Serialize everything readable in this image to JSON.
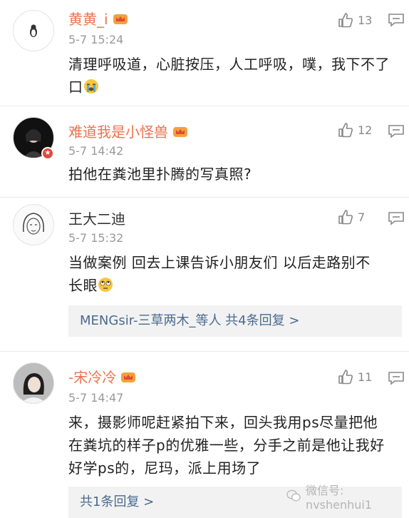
{
  "comments": [
    {
      "username": "黄黄_i",
      "time": "5-7 15:24",
      "likes": "13",
      "text_line1": "清理呼吸道，心脏按压，人工呼吸，噗，我下不了",
      "text_line2": "口",
      "avatar_icon": "penguin-icon",
      "emoji_icon": "crying-face-icon"
    },
    {
      "username": "难道我是小怪兽",
      "time": "5-7 14:42",
      "likes": "12",
      "text_line1": "拍他在粪池里扑腾的写真照?",
      "avatar_icon": "girl-avatar"
    },
    {
      "username": "王大二迪",
      "time": "5-7 15:32",
      "likes": "7",
      "text_line1": "当做案例  回去上课告诉小朋友们  以后走路别不",
      "text_line2": "长眼",
      "replies": "MENGsir-三草两木_等人  共4条回复 >",
      "avatar_icon": "sketch-woman-avatar",
      "emoji_icon": "rolling-eyes-icon"
    },
    {
      "username": "-宋冷冷",
      "time": "5-7 14:47",
      "likes": "11",
      "text_line1": "来，摄影师呢赶紧拍下来，回头我用ps尽量把他",
      "text_line2": "在粪坑的样子p的优雅一些，分手之前是他让我好",
      "text_line3": "好学ps的，尼玛，派上用场了",
      "replies": "共1条回复 >",
      "avatar_icon": "woman-photo-avatar"
    }
  ],
  "watermark": "微信号: nvshenhui1",
  "colors": {
    "vip_name": "#eb7350",
    "reply_link": "#4a6a8f",
    "time": "#9a9a9a"
  }
}
